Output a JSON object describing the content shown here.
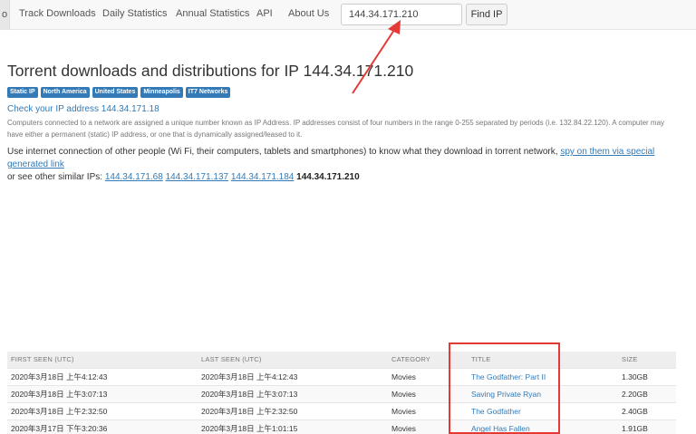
{
  "nav": {
    "first_fragment": "o",
    "items": [
      "Track Downloads",
      "Daily Statistics",
      "Annual Statistics",
      "API",
      "About Us"
    ],
    "search_value": "144.34.171.210",
    "find_label": "Find IP"
  },
  "page": {
    "title": "Torrent downloads and distributions for IP 144.34.171.210",
    "tags": [
      "Static IP",
      "North America",
      "United States",
      "Minneapolis",
      "IT7 Networks"
    ],
    "check_link": "Check your IP address 144.34.171.18",
    "description": "Computers connected to a network are assigned a unique number known as IP Address. IP addresses consist of four numbers in the range 0-255 separated by periods (i.e. 132.84.22.120). A computer may have either a permanent (static) IP address, or one that is dynamically assigned/leased to it.",
    "use_text_1": "Use internet connection of other people (Wi Fi, their computers, tablets and smartphones) to know what they download in torrent network,",
    "spy_link": "spy on them via special generated link",
    "use_text_2": "or see other similar IPs:",
    "similar_ips": [
      "144.34.171.68",
      "144.34.171.137",
      "144.34.171.184"
    ],
    "current_ip": "144.34.171.210"
  },
  "table": {
    "headers": [
      "FIRST SEEN (UTC)",
      "LAST SEEN (UTC)",
      "CATEGORY",
      "TITLE",
      "SIZE"
    ],
    "rows": [
      [
        "2020年3月18日 上午4:12:43",
        "2020年3月18日 上午4:12:43",
        "Movies",
        "The Godfather: Part II",
        "1.30GB"
      ],
      [
        "2020年3月18日 上午3:07:13",
        "2020年3月18日 上午3:07:13",
        "Movies",
        "Saving Private Ryan",
        "2.20GB"
      ],
      [
        "2020年3月18日 上午2:32:50",
        "2020年3月18日 上午2:32:50",
        "Movies",
        "The Godfather",
        "2.40GB"
      ],
      [
        "2020年3月17日 下午3:20:36",
        "2020年3月18日 上午1:01:15",
        "Movies",
        "Angel Has Fallen",
        "1.91GB"
      ]
    ]
  },
  "annotation_color": "#e53935"
}
